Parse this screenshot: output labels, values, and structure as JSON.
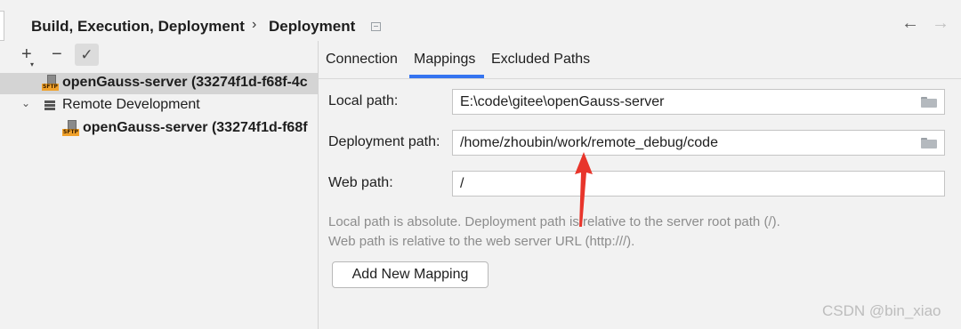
{
  "header": {
    "breadcrumb_parent": "Build, Execution, Deployment",
    "breadcrumb_separator": "›",
    "breadcrumb_current": "Deployment",
    "back_arrow": "←",
    "forward_arrow": "→"
  },
  "toolbar": {
    "add_glyph": "+",
    "remove_glyph": "−",
    "check_glyph": "✓"
  },
  "tree": {
    "server_item": "openGauss-server (33274f1d-f68f-4c",
    "group_label": "Remote Development",
    "group_item": "openGauss-server (33274f1d-f68f",
    "sftp_icon_text": "SFTP",
    "expand_glyph": "⌄"
  },
  "tabs": [
    {
      "label": "Connection"
    },
    {
      "label": "Mappings",
      "active": true
    },
    {
      "label": "Excluded Paths"
    }
  ],
  "mapping": {
    "local_label": "Local path:",
    "local_value": "E:\\code\\gitee\\openGauss-server",
    "deploy_label": "Deployment path:",
    "deploy_value": "/home/zhoubin/work/remote_debug/code",
    "web_label": "Web path:",
    "web_value": "/",
    "hint1": "Local path is absolute. Deployment path is relative to the server root path (/).",
    "hint2": "Web path is relative to the web server URL (http:///).",
    "add_button": "Add New Mapping"
  },
  "watermark": "CSDN @bin_xiao",
  "colors": {
    "accent": "#3574f0",
    "annotation_arrow": "#e8352b",
    "sftp_badge": "#f0a12a"
  },
  "icons": [
    "add-icon",
    "remove-icon",
    "check-icon",
    "sftp-server-icon",
    "server-group-icon",
    "folder-icon",
    "back-arrow-icon",
    "forward-arrow-icon",
    "settings-doc-icon"
  ]
}
